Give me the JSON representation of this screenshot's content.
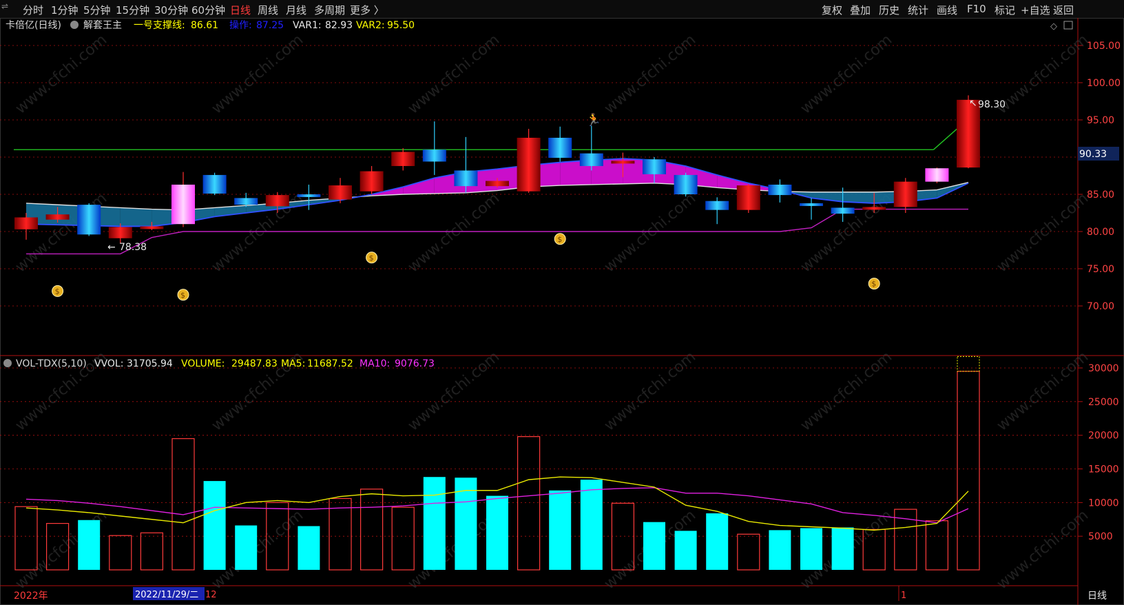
{
  "toolbar": {
    "left": [
      "分时",
      "1分钟",
      "5分钟",
      "15分钟",
      "30分钟",
      "60分钟",
      "日线",
      "周线",
      "月线",
      "多周期",
      "更多 〉"
    ],
    "active": "日线",
    "right": [
      "复权",
      "叠加",
      "历史",
      "统计",
      "画线",
      "F10",
      "标记",
      "+自选",
      "返回"
    ]
  },
  "main_header": {
    "stock": "卡倍亿(日线)",
    "indicator": "解套王主",
    "support_label": "一号支撑线:",
    "support_value": "86.61",
    "op_label": "操作:",
    "op_value": "87.25",
    "var1_label": "VAR1:",
    "var1_value": "82.93",
    "var2_label": "VAR2:",
    "var2_value": "95.50"
  },
  "vol_header": {
    "name": "VOL-TDX(5,10)",
    "vvol_label": "VVOL:",
    "vvol_value": "31705.94",
    "volume_label": "VOLUME:",
    "volume_value": "29487.83",
    "ma5_label": "MA5:",
    "ma5_value": "11687.52",
    "ma10_label": "MA10:",
    "ma10_value": "9076.73"
  },
  "annotations": {
    "high_label": "98.30",
    "low_label": "78.38",
    "current_price": "90.33"
  },
  "bottom": {
    "year_label": "2022年",
    "date_label": "2022/11/29/二",
    "date_suffix": "12",
    "mark_1": "1",
    "period": "日线"
  },
  "watermark": "www.cfchi.com",
  "chart_data": [
    {
      "type": "candlestick",
      "title": "卡倍亿(日线)",
      "ylim": [
        65,
        107
      ],
      "yticks": [
        70,
        75,
        80,
        85,
        90,
        95,
        100,
        105
      ],
      "candles": [
        {
          "o": 80.3,
          "c": 81.9,
          "h": 82.5,
          "l": 78.9,
          "up": true
        },
        {
          "o": 82.3,
          "c": 81.6,
          "h": 83.3,
          "l": 81.2,
          "up": true
        },
        {
          "o": 83.6,
          "c": 79.6,
          "h": 83.8,
          "l": 79.4,
          "up": false
        },
        {
          "o": 80.6,
          "c": 79.1,
          "h": 81.1,
          "l": 78.4,
          "up": true
        },
        {
          "o": 80.7,
          "c": 80.5,
          "h": 81.3,
          "l": 80.2,
          "up": true
        },
        {
          "o": 81.0,
          "c": 86.3,
          "h": 88.0,
          "l": 80.6,
          "up": true
        },
        {
          "o": 87.6,
          "c": 85.1,
          "h": 87.9,
          "l": 84.9,
          "up": false
        },
        {
          "o": 84.5,
          "c": 83.6,
          "h": 85.2,
          "l": 83.3,
          "up": false
        },
        {
          "o": 83.4,
          "c": 84.9,
          "h": 85.3,
          "l": 82.5,
          "up": true
        },
        {
          "o": 85.0,
          "c": 84.9,
          "h": 86.3,
          "l": 82.9,
          "up": false
        },
        {
          "o": 84.3,
          "c": 86.2,
          "h": 87.2,
          "l": 83.8,
          "up": true
        },
        {
          "o": 85.4,
          "c": 88.1,
          "h": 88.8,
          "l": 85.0,
          "up": true
        },
        {
          "o": 88.8,
          "c": 90.7,
          "h": 91.2,
          "l": 88.2,
          "up": true
        },
        {
          "o": 91.0,
          "c": 89.4,
          "h": 94.8,
          "l": 87.6,
          "up": false
        },
        {
          "o": 88.2,
          "c": 86.1,
          "h": 92.7,
          "l": 85.2,
          "up": false
        },
        {
          "o": 86.1,
          "c": 86.8,
          "h": 87.2,
          "l": 85.9,
          "up": true
        },
        {
          "o": 85.4,
          "c": 92.6,
          "h": 93.8,
          "l": 85.2,
          "up": true
        },
        {
          "o": 92.6,
          "c": 89.9,
          "h": 94.1,
          "l": 89.4,
          "up": false
        },
        {
          "o": 90.5,
          "c": 88.8,
          "h": 94.2,
          "l": 88.2,
          "up": false
        },
        {
          "o": 89.5,
          "c": 89.2,
          "h": 90.6,
          "l": 87.3,
          "up": true
        },
        {
          "o": 89.7,
          "c": 87.7,
          "h": 90.0,
          "l": 86.5,
          "up": false
        },
        {
          "o": 87.6,
          "c": 85.0,
          "h": 87.9,
          "l": 84.7,
          "up": false
        },
        {
          "o": 84.1,
          "c": 82.9,
          "h": 84.6,
          "l": 81.0,
          "up": false
        },
        {
          "o": 82.9,
          "c": 86.2,
          "h": 86.4,
          "l": 82.5,
          "up": true
        },
        {
          "o": 86.3,
          "c": 84.9,
          "h": 87.0,
          "l": 83.9,
          "up": false
        },
        {
          "o": 83.7,
          "c": 83.8,
          "h": 84.5,
          "l": 81.6,
          "up": false
        },
        {
          "o": 83.2,
          "c": 82.4,
          "h": 85.9,
          "l": 81.3,
          "up": false
        },
        {
          "o": 83.2,
          "c": 83.3,
          "h": 85.2,
          "l": 82.5,
          "up": true
        },
        {
          "o": 83.3,
          "c": 86.7,
          "h": 87.2,
          "l": 82.5,
          "up": true
        },
        {
          "o": 86.7,
          "c": 88.5,
          "h": 88.6,
          "l": 86.5,
          "up": true
        },
        {
          "o": 88.6,
          "c": 97.7,
          "h": 98.3,
          "l": 88.5,
          "up": true
        }
      ],
      "lines": {
        "white": [
          83.8,
          83.6,
          83.4,
          83.2,
          83.0,
          82.9,
          83.2,
          83.5,
          83.8,
          84.2,
          84.5,
          84.8,
          85.0,
          85.1,
          85.2,
          85.5,
          86.0,
          86.2,
          86.3,
          86.4,
          86.5,
          86.3,
          85.9,
          85.6,
          85.4,
          85.3,
          85.3,
          85.3,
          85.4,
          85.6,
          86.6
        ],
        "green_support": 91.0,
        "green_tail_end": 94.0,
        "purple": [
          77.0,
          77.0,
          77.0,
          77.0,
          79.2,
          80.0,
          80.0,
          80.0,
          80.0,
          80.0,
          80.0,
          80.0,
          80.0,
          80.0,
          80.0,
          80.0,
          80.0,
          80.0,
          80.0,
          80.0,
          80.0,
          80.0,
          80.0,
          80.0,
          80.0,
          80.5,
          83.0,
          83.0,
          83.0,
          83.0,
          83.0
        ],
        "blue": [
          81.0,
          80.9,
          80.8,
          80.7,
          80.7,
          81.2,
          82.0,
          82.5,
          83.0,
          83.6,
          84.2,
          85.0,
          86.0,
          87.2,
          88.0,
          88.4,
          88.9,
          89.3,
          89.6,
          89.8,
          89.6,
          88.8,
          87.6,
          86.5,
          85.6,
          84.5,
          84.0,
          83.8,
          84.0,
          84.5,
          86.5
        ]
      },
      "markers": [
        {
          "type": "money",
          "x_index": 1,
          "price": 72.0
        },
        {
          "type": "money",
          "x_index": 5,
          "price": 71.5
        },
        {
          "type": "money",
          "x_index": 11,
          "price": 76.5
        },
        {
          "type": "money",
          "x_index": 17,
          "price": 79.0
        },
        {
          "type": "money",
          "x_index": 27,
          "price": 73.0
        },
        {
          "type": "person",
          "x_index": 18,
          "price": 95.0
        }
      ]
    },
    {
      "type": "bar",
      "title": "VOL-TDX(5,10)",
      "ylim": [
        0,
        33000
      ],
      "yticks": [
        5000,
        10000,
        15000,
        20000,
        25000,
        30000
      ],
      "values": [
        9400,
        6900,
        7400,
        5100,
        5500,
        19500,
        13200,
        6600,
        10000,
        6500,
        10600,
        12000,
        9300,
        13800,
        13700,
        11000,
        19800,
        11800,
        13400,
        9900,
        7100,
        5800,
        8400,
        5300,
        5900,
        6200,
        6300,
        6000,
        9000,
        7300,
        29500
      ],
      "up": [
        true,
        true,
        false,
        true,
        true,
        true,
        false,
        false,
        true,
        false,
        true,
        true,
        true,
        false,
        false,
        false,
        true,
        false,
        false,
        true,
        false,
        false,
        false,
        true,
        false,
        false,
        false,
        true,
        true,
        true,
        true
      ],
      "ma5": [
        9200,
        8900,
        8500,
        8000,
        7500,
        7000,
        8800,
        10000,
        10300,
        10000,
        10900,
        11300,
        11000,
        11100,
        11800,
        11800,
        13400,
        13800,
        13700,
        13000,
        12300,
        9600,
        8700,
        7200,
        6600,
        6400,
        6200,
        5900,
        6300,
        6900,
        11700
      ],
      "ma10": [
        10500,
        10300,
        9900,
        9400,
        8800,
        8200,
        9300,
        9200,
        9100,
        9000,
        9200,
        9300,
        9500,
        9900,
        10100,
        10600,
        11000,
        11400,
        11900,
        12100,
        12200,
        11400,
        11400,
        11000,
        10400,
        9800,
        8500,
        8100,
        7600,
        7000,
        9100
      ],
      "vvol_box": 31706
    }
  ]
}
